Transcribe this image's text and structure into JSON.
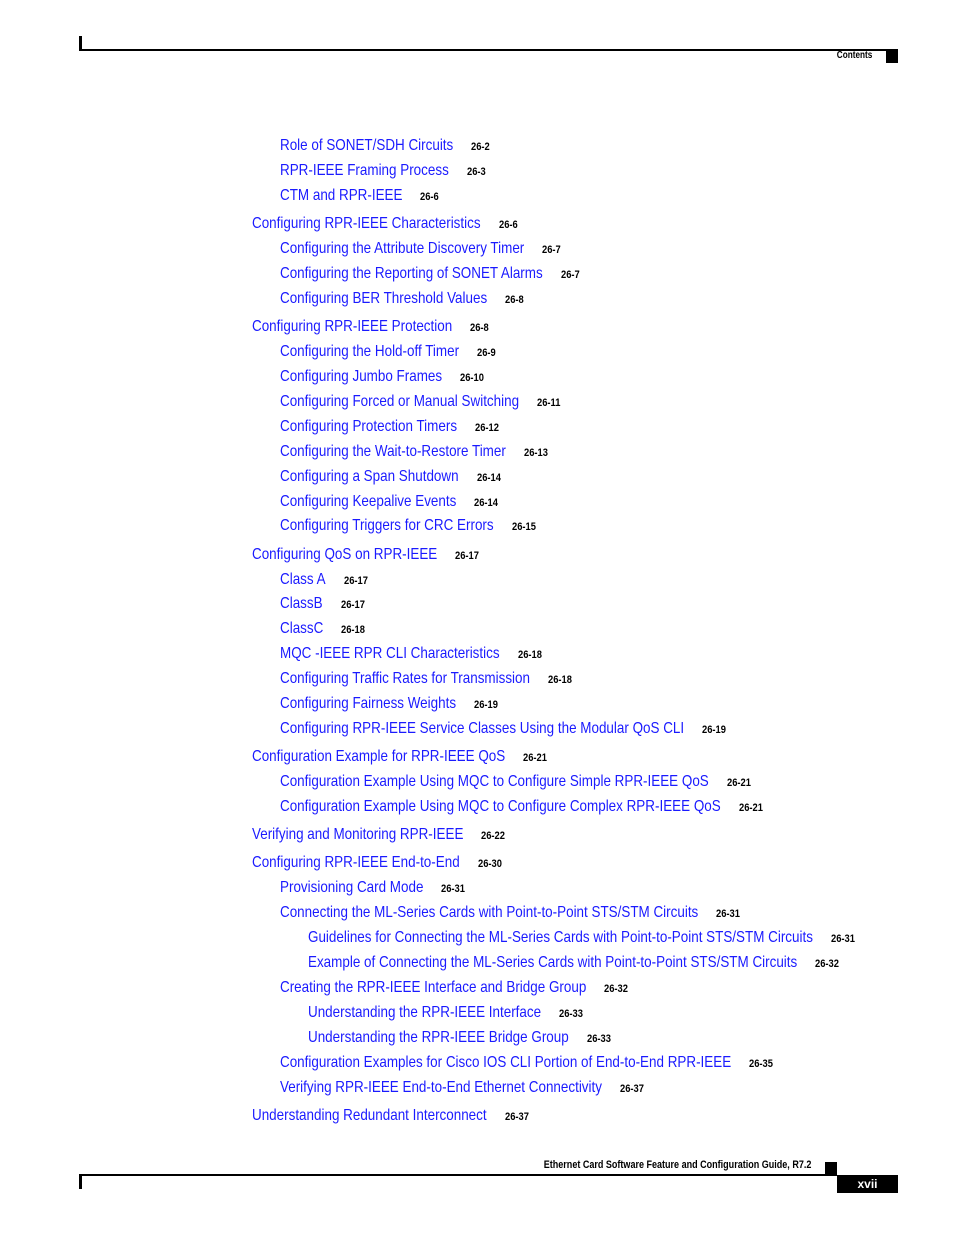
{
  "header": {
    "section_label": "Contents"
  },
  "footer": {
    "book_title": "Ethernet Card Software Feature and Configuration Guide, R7.2",
    "page_number": "xvii"
  },
  "toc": [
    {
      "level": 2,
      "title": "Role of SONET/SDH Circuits",
      "page": "26-2"
    },
    {
      "level": 2,
      "title": "RPR-IEEE Framing Process",
      "page": "26-3"
    },
    {
      "level": 2,
      "title": "CTM and RPR-IEEE",
      "page": "26-6"
    },
    {
      "level": 1,
      "title": "Configuring RPR-IEEE Characteristics",
      "page": "26-6"
    },
    {
      "level": 2,
      "title": "Configuring the Attribute Discovery Timer",
      "page": "26-7"
    },
    {
      "level": 2,
      "title": "Configuring the Reporting of SONET Alarms",
      "page": "26-7"
    },
    {
      "level": 2,
      "title": "Configuring BER Threshold Values",
      "page": "26-8"
    },
    {
      "level": 1,
      "title": "Configuring RPR-IEEE Protection",
      "page": "26-8"
    },
    {
      "level": 2,
      "title": "Configuring the Hold-off Timer",
      "page": "26-9"
    },
    {
      "level": 2,
      "title": "Configuring Jumbo Frames",
      "page": "26-10"
    },
    {
      "level": 2,
      "title": "Configuring Forced or Manual Switching",
      "page": "26-11"
    },
    {
      "level": 2,
      "title": "Configuring Protection Timers",
      "page": "26-12"
    },
    {
      "level": 2,
      "title": "Configuring the Wait-to-Restore Timer",
      "page": "26-13"
    },
    {
      "level": 2,
      "title": "Configuring a Span Shutdown",
      "page": "26-14"
    },
    {
      "level": 2,
      "title": "Configuring Keepalive Events",
      "page": "26-14"
    },
    {
      "level": 2,
      "title": "Configuring Triggers for CRC Errors",
      "page": "26-15"
    },
    {
      "level": 1,
      "title": "Configuring QoS on RPR-IEEE",
      "page": "26-17"
    },
    {
      "level": 2,
      "title": "Class A",
      "page": "26-17"
    },
    {
      "level": 2,
      "title": "ClassB",
      "page": "26-17"
    },
    {
      "level": 2,
      "title": "ClassC",
      "page": "26-18"
    },
    {
      "level": 2,
      "title": "MQC -IEEE RPR CLI Characteristics",
      "page": "26-18"
    },
    {
      "level": 2,
      "title": "Configuring Traffic Rates for Transmission",
      "page": "26-18"
    },
    {
      "level": 2,
      "title": "Configuring Fairness Weights",
      "page": "26-19"
    },
    {
      "level": 2,
      "title": "Configuring RPR-IEEE Service Classes Using the Modular QoS CLI",
      "page": "26-19"
    },
    {
      "level": 1,
      "title": "Configuration Example for RPR-IEEE QoS",
      "page": "26-21"
    },
    {
      "level": 2,
      "title": "Configuration Example Using MQC to Configure Simple RPR-IEEE QoS",
      "page": "26-21"
    },
    {
      "level": 2,
      "title": "Configuration Example Using MQC to Configure Complex RPR-IEEE QoS",
      "page": "26-21"
    },
    {
      "level": 1,
      "title": "Verifying and Monitoring RPR-IEEE",
      "page": "26-22"
    },
    {
      "level": 1,
      "title": "Configuring RPR-IEEE End-to-End",
      "page": "26-30"
    },
    {
      "level": 2,
      "title": "Provisioning Card Mode",
      "page": "26-31"
    },
    {
      "level": 2,
      "title": "Connecting the ML-Series Cards with Point-to-Point STS/STM Circuits",
      "page": "26-31"
    },
    {
      "level": 3,
      "title": "Guidelines for Connecting the ML-Series Cards with Point-to-Point STS/STM Circuits",
      "page": "26-31"
    },
    {
      "level": 3,
      "title": "Example of Connecting the ML-Series Cards with Point-to-Point STS/STM Circuits",
      "page": "26-32"
    },
    {
      "level": 2,
      "title": "Creating the RPR-IEEE Interface and Bridge Group",
      "page": "26-32"
    },
    {
      "level": 3,
      "title": "Understanding the RPR-IEEE Interface",
      "page": "26-33"
    },
    {
      "level": 3,
      "title": "Understanding the RPR-IEEE Bridge Group",
      "page": "26-33"
    },
    {
      "level": 2,
      "title": "Configuration Examples for Cisco IOS CLI Portion of End-to-End RPR-IEEE",
      "page": "26-35"
    },
    {
      "level": 2,
      "title": "Verifying RPR-IEEE End-to-End Ethernet Connectivity",
      "page": "26-37"
    },
    {
      "level": 1,
      "title": "Understanding Redundant Interconnect",
      "page": "26-37"
    }
  ]
}
